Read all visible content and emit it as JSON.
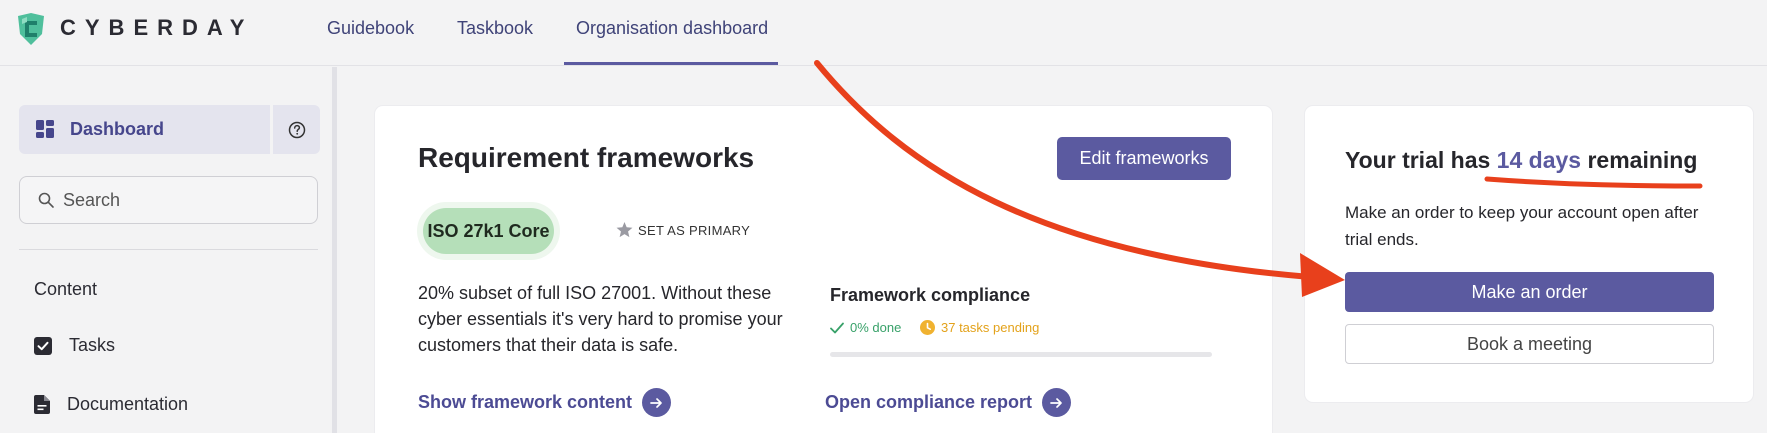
{
  "brand": {
    "name": "CYBERDAY"
  },
  "nav": {
    "tabs": [
      {
        "label": "Guidebook"
      },
      {
        "label": "Taskbook"
      },
      {
        "label": "Organisation dashboard",
        "active": true
      }
    ]
  },
  "sidebar": {
    "dashboard_label": "Dashboard",
    "search_placeholder": "Search",
    "section_title": "Content",
    "items": [
      {
        "label": "Tasks",
        "icon": "checkbox-icon"
      },
      {
        "label": "Documentation",
        "icon": "document-icon"
      }
    ]
  },
  "frameworks": {
    "title": "Requirement frameworks",
    "edit_label": "Edit frameworks",
    "framework_name": "ISO 27k1 Core",
    "primary_label": "SET AS PRIMARY",
    "description": "20% subset of full ISO 27001. Without these cyber essentials it's very hard to promise your customers that their data is safe.",
    "compliance_title": "Framework compliance",
    "done_label": "0% done",
    "pending_label": "37 tasks pending",
    "progress_fraction": 0,
    "show_content_label": "Show framework content",
    "report_label": "Open compliance report"
  },
  "trial": {
    "title_prefix": "Your trial has ",
    "days": "14 days",
    "title_suffix": " remaining",
    "text": "Make an order to keep your account open after trial ends.",
    "order_label": "Make an order",
    "meeting_label": "Book a meeting"
  },
  "colors": {
    "accent": "#5b5aa0",
    "annotation": "#e8401c",
    "success": "#38a169",
    "warning": "#e3a21b",
    "pill": "#b5dfb9"
  }
}
